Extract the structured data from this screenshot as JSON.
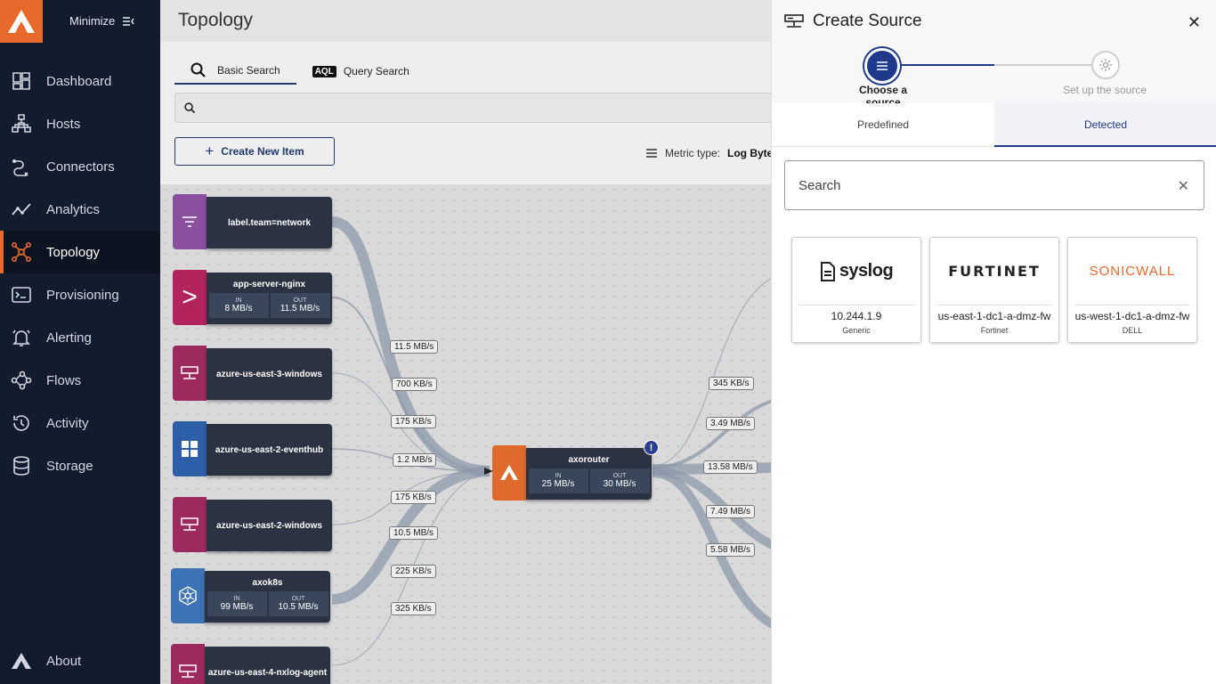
{
  "sidebar": {
    "minimize_label": "Minimize",
    "items": [
      {
        "label": "Dashboard",
        "icon": "dashboard-icon"
      },
      {
        "label": "Hosts",
        "icon": "hosts-icon"
      },
      {
        "label": "Connectors",
        "icon": "connectors-icon"
      },
      {
        "label": "Analytics",
        "icon": "analytics-icon"
      },
      {
        "label": "Topology",
        "icon": "topology-icon",
        "active": true
      },
      {
        "label": "Provisioning",
        "icon": "provisioning-icon"
      },
      {
        "label": "Alerting",
        "icon": "alerting-icon"
      },
      {
        "label": "Flows",
        "icon": "flows-icon"
      },
      {
        "label": "Activity",
        "icon": "activity-icon"
      },
      {
        "label": "Storage",
        "icon": "storage-icon"
      }
    ],
    "about_label": "About"
  },
  "main": {
    "title": "Topology",
    "tabs": [
      {
        "label": "Basic Search",
        "active": true
      },
      {
        "label": "Query Search",
        "badge": "AQL"
      }
    ],
    "create_button": "Create New Item",
    "metric_label": "Metric type:",
    "metric_value": "Log Bytes"
  },
  "topology": {
    "nodes": [
      {
        "name": "label.team=network",
        "color": "#8b4fa0"
      },
      {
        "name": "app-server-nginx",
        "in": "8 MB/s",
        "out": "11.5 MB/s",
        "color": "#b3245e"
      },
      {
        "name": "azure-us-east-3-windows",
        "color": "#9c2a5e"
      },
      {
        "name": "azure-us-east-2-eventhub",
        "color": "#2d5ea8"
      },
      {
        "name": "azure-us-east-2-windows",
        "color": "#9c2a5e"
      },
      {
        "name": "axok8s",
        "in": "99 MB/s",
        "out": "10.5 MB/s",
        "color": "#3d73b5"
      },
      {
        "name": "azure-us-east-4-nxlog-agent",
        "color": "#9c2a5e"
      }
    ],
    "router": {
      "name": "axorouter",
      "in": "25 MB/s",
      "out": "30 MB/s",
      "color": "#e06a2c"
    },
    "stat_in_label": "IN",
    "stat_out_label": "OUT",
    "left_rates": [
      "11.5 MB/s",
      "700 KB/s",
      "175 KB/s",
      "1.2 MB/s",
      "175 KB/s",
      "10.5 MB/s",
      "225 KB/s",
      "325 KB/s"
    ],
    "right_rates": [
      "345 KB/s",
      "3.49 MB/s",
      "13.58 MB/s",
      "7.49 MB/s",
      "5.58 MB/s"
    ]
  },
  "panel": {
    "title": "Create Source",
    "steps": [
      {
        "label": "Choose a source",
        "active": true
      },
      {
        "label": "Set up the source",
        "active": false
      }
    ],
    "tabs": [
      {
        "label": "Predefined",
        "active": false
      },
      {
        "label": "Detected",
        "active": true
      }
    ],
    "search_placeholder": "Search",
    "cards": [
      {
        "logo": "syslog",
        "name": "10.244.1.9",
        "sub": "Generic"
      },
      {
        "logo": "FURTINET",
        "name": "us-east-1-dc1-a-dmz-fw",
        "sub": "Fortinet"
      },
      {
        "logo": "SONICWALL",
        "name": "us-west-1-dc1-a-dmz-fw",
        "sub": "DELL"
      }
    ]
  },
  "colors": {
    "sidebar_bg": "#131c2e",
    "accent": "#e8692c",
    "primary": "#1f3a8a"
  }
}
